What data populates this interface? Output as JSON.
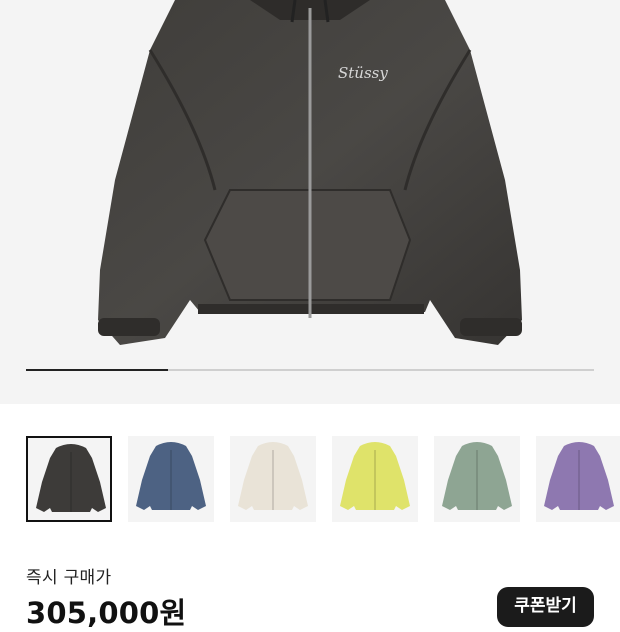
{
  "product": {
    "main_image": "black-zip-hooded-jacket",
    "logo_text": "Stüssy",
    "slide_progress": 0.25
  },
  "thumbnails": [
    {
      "name": "black",
      "color": "#3d3b39",
      "selected": true
    },
    {
      "name": "blue",
      "color": "#4d6283",
      "selected": false
    },
    {
      "name": "cream",
      "color": "#e9e3d7",
      "selected": false
    },
    {
      "name": "yellow",
      "color": "#dfe36a",
      "selected": false
    },
    {
      "name": "sage",
      "color": "#8ea593",
      "selected": false
    },
    {
      "name": "purple",
      "color": "#8e78b0",
      "selected": false
    }
  ],
  "price": {
    "label": "즉시 구매가",
    "value": "305,000원"
  },
  "coupon": {
    "label": "쿠폰받기"
  }
}
